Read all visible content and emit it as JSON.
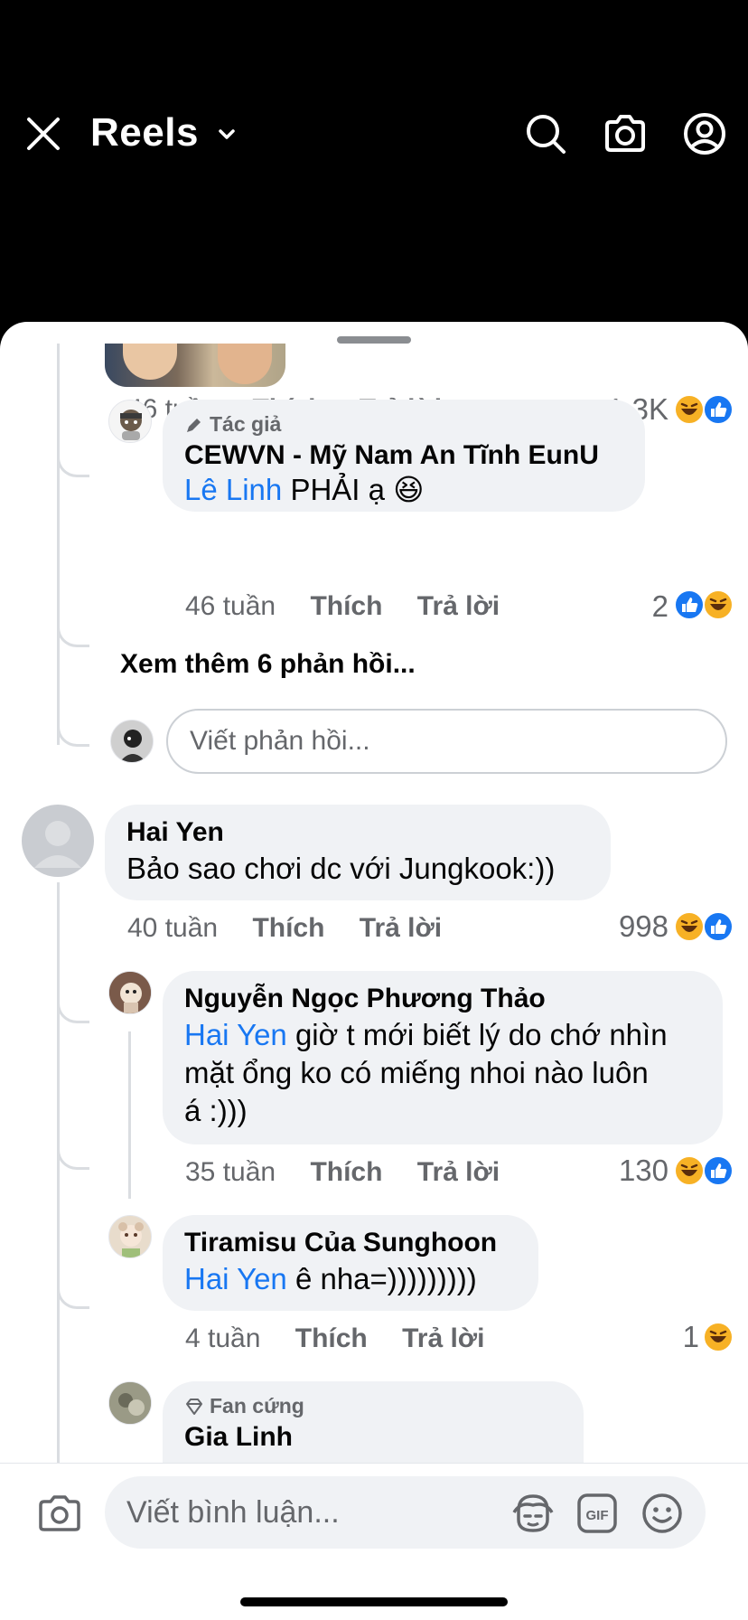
{
  "header": {
    "title": "Reels"
  },
  "colors": {
    "accent": "#1877f2",
    "text": "#050505",
    "secondary": "#65676b",
    "bubble": "#f0f2f5"
  },
  "actions": {
    "like": "Thích",
    "reply": "Trả lời"
  },
  "comments": {
    "c0": {
      "time": "46 tuần",
      "count": "1,3K"
    },
    "c1": {
      "badge": "Tác giả",
      "author": "CEWVN - Mỹ Nam An Tĩnh EunU",
      "mention": "Lê Linh",
      "text": "PHẢI ạ 😆",
      "time": "46 tuần",
      "count": "2"
    },
    "see_more": "Xem thêm 6 phản hồi...",
    "reply_placeholder": "Viết phản hồi...",
    "c2": {
      "author": "Hai Yen",
      "text": "Bảo sao chơi dc với Jungkook:))",
      "time": "40 tuần",
      "count": "998"
    },
    "c3": {
      "author": "Nguyễn Ngọc Phương Thảo",
      "mention": "Hai Yen",
      "text_line1": "giờ t mới biết lý do chớ nhìn",
      "text_line2": "mặt ổng ko có miếng nhoi nào luôn",
      "text_line3": "á :)))",
      "time": "35 tuần",
      "count": "130"
    },
    "c4": {
      "author": "Tiramisu Của Sunghoon",
      "mention": "Hai Yen",
      "text": "ê nha=)))))))))",
      "time": "4 tuần",
      "count": "1"
    },
    "c5": {
      "badge": "Fan cứng",
      "author": "Gia Linh"
    }
  },
  "composer": {
    "placeholder": "Viết bình luận..."
  }
}
